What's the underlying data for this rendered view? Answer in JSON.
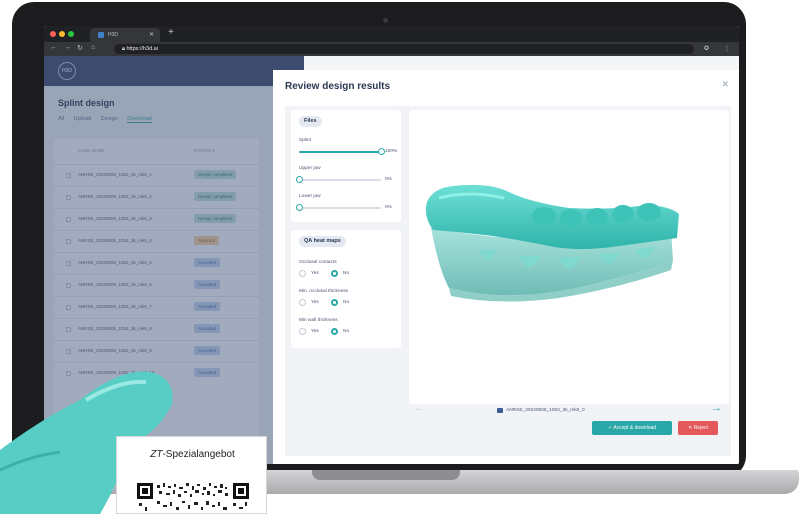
{
  "browser": {
    "tab_title": "H3D",
    "url": "https://h3d.ai"
  },
  "left_pane": {
    "title": "Splint design",
    "tabs": [
      "All",
      "Upload",
      "Design",
      "Download"
    ],
    "active_tab": "Download",
    "columns": [
      "CASE NAME",
      "STATUS"
    ],
    "rows": [
      {
        "name": "ANRSE_20220506_1052_3k_mk6_1",
        "status": "Design completed"
      },
      {
        "name": "ANRSE_20220506_1052_3k_mk6_2",
        "status": "Design completed"
      },
      {
        "name": "ANRSE_20220506_1052_3k_mk6_3",
        "status": "Design completed"
      },
      {
        "name": "ANRSE_20220506_1052_3k_mk6_4",
        "status": "Rejected"
      },
      {
        "name": "ANRSE_20220506_1052_3k_mk6_5",
        "status": "Accepted"
      },
      {
        "name": "ANRSE_20220506_1052_3k_mk6_6",
        "status": "Accepted"
      },
      {
        "name": "ANRSE_20220506_1052_3k_mk6_7",
        "status": "Accepted"
      },
      {
        "name": "ANRSE_20220506_1052_3k_mk6_8",
        "status": "Accepted"
      },
      {
        "name": "ANRSE_20220506_1052_3k_mk6_9",
        "status": "Accepted"
      },
      {
        "name": "ANRSE_20220506_1052_3k_mk6_10",
        "status": "Accepted"
      }
    ]
  },
  "modal": {
    "title": "Review design results",
    "files": {
      "header": "Files",
      "items": [
        {
          "label": "Splint",
          "value_text": "100%",
          "value": 1.0
        },
        {
          "label": "Upper jaw",
          "value_text": "0%",
          "value": 0.0
        },
        {
          "label": "Lower jaw",
          "value_text": "0%",
          "value": 0.0
        }
      ]
    },
    "heatmaps": {
      "header": "QA heat maps",
      "groups": [
        {
          "label": "Occlusal contacts",
          "yes": "Yes",
          "no": "No",
          "selected": "No"
        },
        {
          "label": "Min. occlusal thickness",
          "yes": "Yes",
          "no": "No",
          "selected": "No"
        },
        {
          "label": "Min wall thickness",
          "yes": "Yes",
          "no": "No",
          "selected": "No"
        }
      ]
    },
    "file_name": "ANRSE_20220506_1052_3k_mk6_0",
    "accept_label": "✓  Accept & download",
    "reject_label": "✕  Reject"
  },
  "promo": {
    "prefix": "ZT",
    "text": "-Spezialangebot"
  },
  "colors": {
    "accent": "#2aa7a7",
    "reject": "#e2585b",
    "splint": "#5ccfc7"
  }
}
